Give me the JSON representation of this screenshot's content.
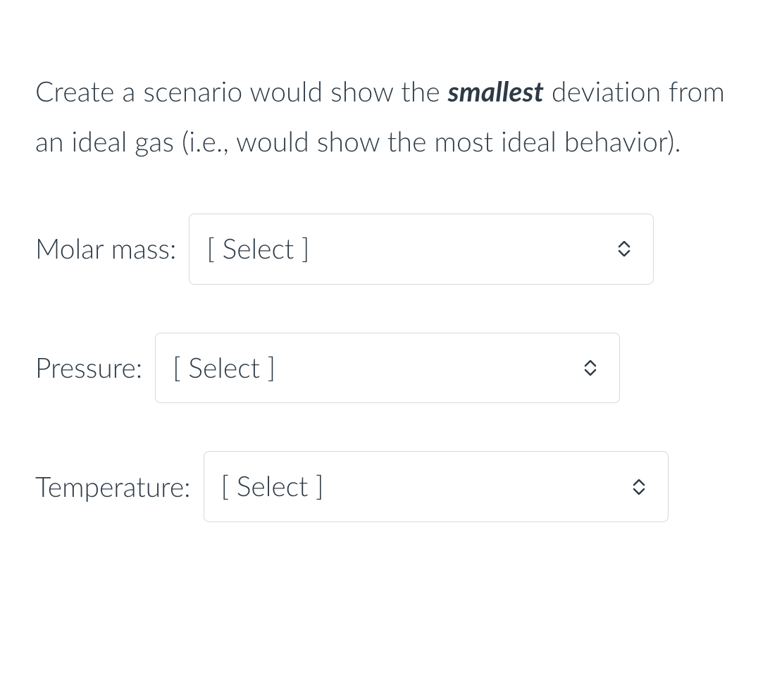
{
  "prompt": {
    "part1": "Create a scenario would show the ",
    "emphasis": "smallest",
    "part2": " deviation from an ideal gas (i.e., would show the most ideal behavior)."
  },
  "fields": {
    "molar_mass": {
      "label": "Molar mass:",
      "placeholder": "[ Select ]"
    },
    "pressure": {
      "label": "Pressure:",
      "placeholder": "[ Select ]"
    },
    "temperature": {
      "label": "Temperature:",
      "placeholder": "[ Select ]"
    }
  }
}
